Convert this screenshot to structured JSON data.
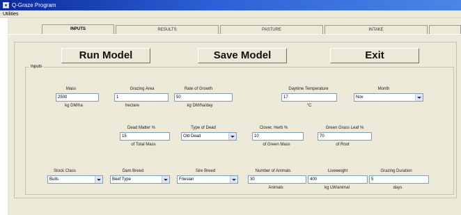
{
  "window": {
    "title": "Q-Graze Program"
  },
  "menu": {
    "items": [
      "Utilities"
    ]
  },
  "tabs": [
    "INPUTS",
    "RESULTS",
    "PASTURE",
    "INTAKE"
  ],
  "buttons": {
    "run": "Run Model",
    "save": "Save Model",
    "exit": "Exit"
  },
  "group_label": "Inputs",
  "fields": {
    "mass": {
      "label": "Mass",
      "value": "2500",
      "unit": "kg DM/ha"
    },
    "grazing_area": {
      "label": "Grazing Area",
      "value": "1",
      "unit": "hectare"
    },
    "growth_rate": {
      "label": "Rate of Growth",
      "value": "50",
      "unit": "kg DM/ha/day"
    },
    "daytime_temp": {
      "label": "Daytime Temperature",
      "value": "17",
      "unit": "°C"
    },
    "month": {
      "label": "Month",
      "value": "Nov"
    },
    "dead_matter": {
      "label": "Dead Matter %",
      "value": "15",
      "unit": "of Total Mass"
    },
    "type_of_dead": {
      "label": "Type of Dead",
      "value": "Old Dead"
    },
    "clover_herb": {
      "label": "Clover, Herb %",
      "value": "10",
      "unit": "of Green Mass"
    },
    "green_grass_leaf": {
      "label": "Green Grass Leaf %",
      "value": "70",
      "unit": "of Root"
    },
    "stock_class": {
      "label": "Stock Class",
      "value": "Bulls"
    },
    "dam_breed": {
      "label": "Dam Breed",
      "value": "Beef Type"
    },
    "sire_breed": {
      "label": "Sire Breed",
      "value": "Friesian"
    },
    "num_animals": {
      "label": "Number of Animals",
      "value": "30",
      "unit": "Animals"
    },
    "liveweight": {
      "label": "Liveweight",
      "value": "400",
      "unit": "kg LW/animal"
    },
    "grazing_duration": {
      "label": "Grazing Duration",
      "value": "5",
      "unit": "days"
    }
  }
}
